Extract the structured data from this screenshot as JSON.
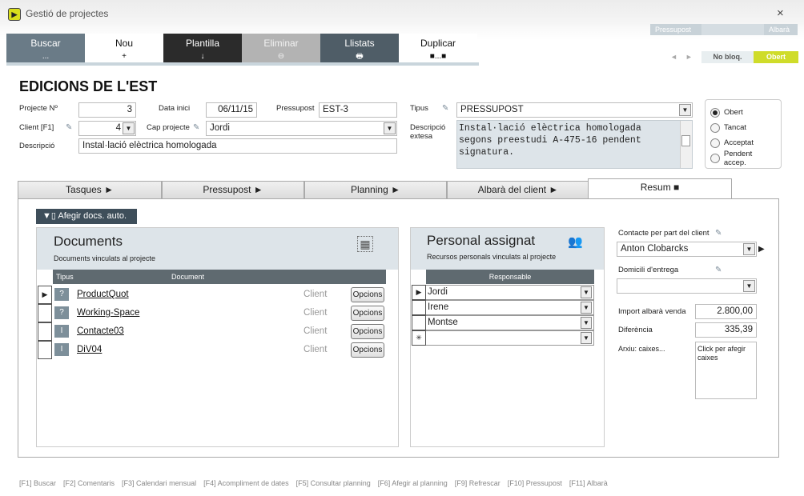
{
  "window": {
    "title": "Gestió de projectes",
    "close": "×",
    "app_icon": "▶"
  },
  "toolbar": [
    {
      "label": "Buscar",
      "sym": "...",
      "bg": "#6a7b87",
      "color": "#ffffff"
    },
    {
      "label": "Nou",
      "sym": "+",
      "bg": "#ffffff",
      "color": "#111111"
    },
    {
      "label": "Plantilla",
      "sym": "↓",
      "bg": "#2b2b2b",
      "color": "#ffffff"
    },
    {
      "label": "Eliminar",
      "sym": "⊖",
      "bg": "#b3b3b3",
      "color": "#f2f2f2"
    },
    {
      "label": "Llistats",
      "sym": "🖶",
      "bg": "#4f5d67",
      "color": "#ffffff"
    },
    {
      "label": "Duplicar",
      "sym": "■...■",
      "bg": "#ffffff",
      "color": "#111111"
    }
  ],
  "pager": {
    "pressupost": "Pressupost",
    "albara": "Albarà",
    "prev": "◄",
    "next": "►"
  },
  "status": {
    "nobloq": "No bloq.",
    "obert": "Obert"
  },
  "company": "EDICIONS DE L'EST",
  "form": {
    "projecte_label": "Projecte Nº",
    "projecte": "3",
    "data_inici_label": "Data inici",
    "data_inici": "06/11/15",
    "pressupost_label": "Pressupost",
    "pressupost": "EST-3",
    "client_label": "Client [F1]",
    "client": "4",
    "cap_label": "Cap projecte",
    "cap": "Jordi",
    "descripcio_label": "Descripció",
    "descripcio": "Instal·lació elèctrica homologada",
    "tipus_label": "Tipus",
    "tipus": "PRESSUPOST",
    "desc_ext_label_1": "Descripció",
    "desc_ext_label_2": "extesa",
    "desc_ext": "Instal·lació elèctrica homologada segons preestudi A-475-16 pendent signatura."
  },
  "status_radios": [
    {
      "label": "Obert",
      "checked": true
    },
    {
      "label": "Tancat",
      "checked": false
    },
    {
      "label": "Acceptat",
      "checked": false
    },
    {
      "label": "Pendent accep.",
      "checked": false
    }
  ],
  "tabs": [
    {
      "label": "Tasques  ►"
    },
    {
      "label": "Pressupost  ►"
    },
    {
      "label": "Planning  ►"
    },
    {
      "label": "Albarà del client  ►"
    },
    {
      "label": "Resum  ■"
    }
  ],
  "afegir_docs": "▼▯  Afegir docs. auto.",
  "documents": {
    "title": "Documents",
    "subtitle": "Documents vinculats al projecte",
    "col_tipus": "Tipus",
    "col_document": "Document",
    "grid_icon": "▦",
    "rows": [
      {
        "tipus": "?",
        "name": "ProductQuot",
        "client": "Client",
        "button": "Opcions",
        "current": true
      },
      {
        "tipus": "?",
        "name": "Working-Space",
        "client": "Client",
        "button": "Opcions",
        "current": false
      },
      {
        "tipus": "I",
        "name": "Contacte03",
        "client": "Client",
        "button": "Opcions",
        "current": false
      },
      {
        "tipus": "I",
        "name": "DiV04",
        "client": "Client",
        "button": "Opcions",
        "current": false
      }
    ]
  },
  "personal": {
    "title": "Personal assignat",
    "subtitle": "Recursos personals vinculats al projecte",
    "col_responsable": "Responsable",
    "icon": "👥",
    "rows": [
      {
        "value": "Jordi",
        "marker": "▶"
      },
      {
        "value": "Irene",
        "marker": ""
      },
      {
        "value": "Montse",
        "marker": ""
      },
      {
        "value": "",
        "marker": "✳"
      }
    ]
  },
  "right": {
    "contacte_label": "Contacte per part del client",
    "contacte": "Anton Clobarcks",
    "domicili_label": "Domicili d'entrega",
    "domicili": "",
    "import_label": "Import albarà venda",
    "import": "2.800,00",
    "diferencia_label": "Diferència",
    "diferencia": "335,39",
    "arxiu_label": "Arxiu: caixes...",
    "arxiu": "Click per afegir caixes"
  },
  "footer": [
    "[F1] Buscar",
    "[F2] Comentaris",
    "[F3] Calendari mensual",
    "[F4] Acompliment de dates",
    "[F5] Consultar planning",
    "[F6] Afegir al planning",
    "[F9] Refrescar",
    "[F10] Pressupost",
    "[F11] Albarà"
  ]
}
